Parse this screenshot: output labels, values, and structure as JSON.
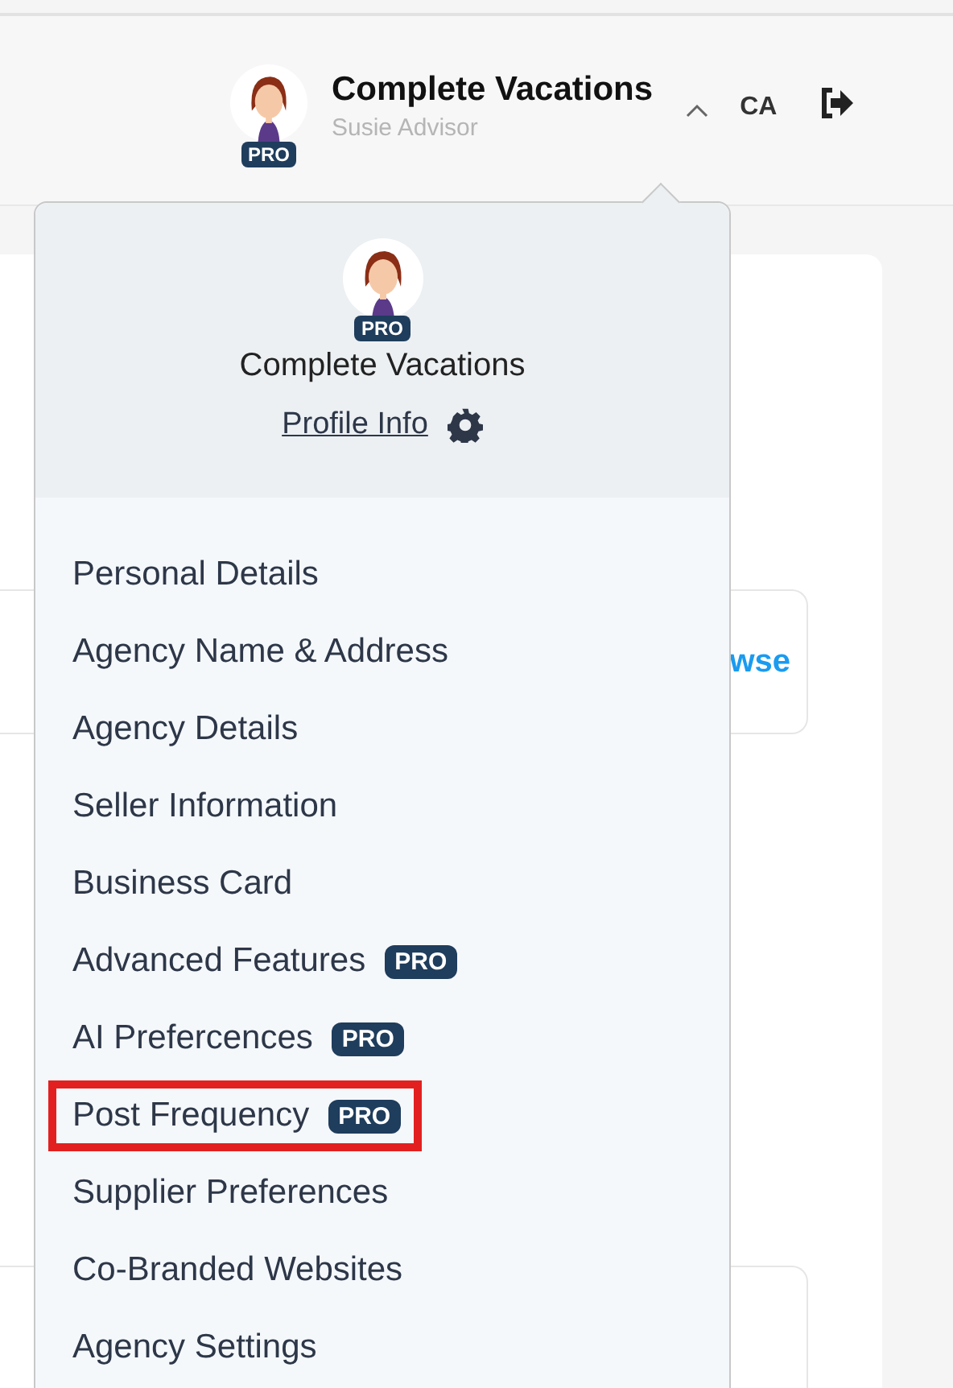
{
  "header": {
    "avatar_badge": "PRO",
    "title": "Complete Vacations",
    "subtitle": "Susie Advisor",
    "expanded": true,
    "locale": "CA"
  },
  "background": {
    "link": "wse"
  },
  "dropdown": {
    "avatar_badge": "PRO",
    "title": "Complete Vacations",
    "profile_link": "Profile Info",
    "items": [
      {
        "label": "Personal Details",
        "highlighted": false
      },
      {
        "label": "Agency Name & Address",
        "highlighted": false
      },
      {
        "label": "Agency Details",
        "highlighted": false
      },
      {
        "label": "Seller Information",
        "highlighted": false
      },
      {
        "label": "Business Card",
        "highlighted": false
      },
      {
        "label": "Advanced Features",
        "badge": "PRO",
        "highlighted": false
      },
      {
        "label": "AI Prefercences",
        "badge": "PRO",
        "highlighted": false
      },
      {
        "label": "Post Frequency",
        "badge": "PRO",
        "highlighted": true
      },
      {
        "label": "Supplier Preferences",
        "highlighted": false
      },
      {
        "label": "Co-Branded Websites",
        "highlighted": false
      },
      {
        "label": "Agency Settings",
        "highlighted": false
      }
    ]
  }
}
